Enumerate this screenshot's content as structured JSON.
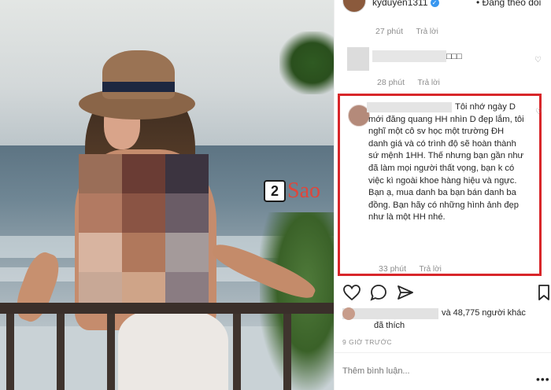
{
  "header": {
    "username": "kyduyen1311",
    "follow_label": "Đang theo dõi"
  },
  "comments": [
    {
      "time": "27 phút",
      "reply_label": "Trả lời"
    },
    {
      "text": "□□□",
      "time": "28 phút",
      "reply_label": "Trả lời"
    },
    {
      "text": "Tôi nhớ ngày D mới đăng quang HH nhìn D đẹp lắm, tôi nghĩ một cô sv học một trường ĐH danh giá và có trình độ sẽ hoàn thành sứ mệnh 1HH. Thế nhưng bạn gần như đã làm mọi người thất vọng, bạn k có việc kì ngoài khoe hàng hiệu và ngực. Bạn ạ, mua danh ba bạn bán danh ba đồng. Bạn hãy có những hình ảnh đẹp như là một HH nhé.",
      "time": "33 phút",
      "reply_label": "Trả lời"
    }
  ],
  "likes": {
    "line1": "và 48,775 người khác",
    "line2": "đã thích"
  },
  "time_ago": "9 GIỜ TRƯỚC",
  "comment_input": {
    "placeholder": "Thêm bình luận..."
  },
  "watermark": {
    "number": "2",
    "text": "Sao"
  },
  "colors": {
    "highlight_border": "#d8262a",
    "watermark_red": "#e0463a",
    "verified_blue": "#3897f0"
  },
  "icons": [
    "heart-icon",
    "comment-icon",
    "share-icon",
    "bookmark-icon",
    "verified-icon",
    "more-options-icon"
  ]
}
